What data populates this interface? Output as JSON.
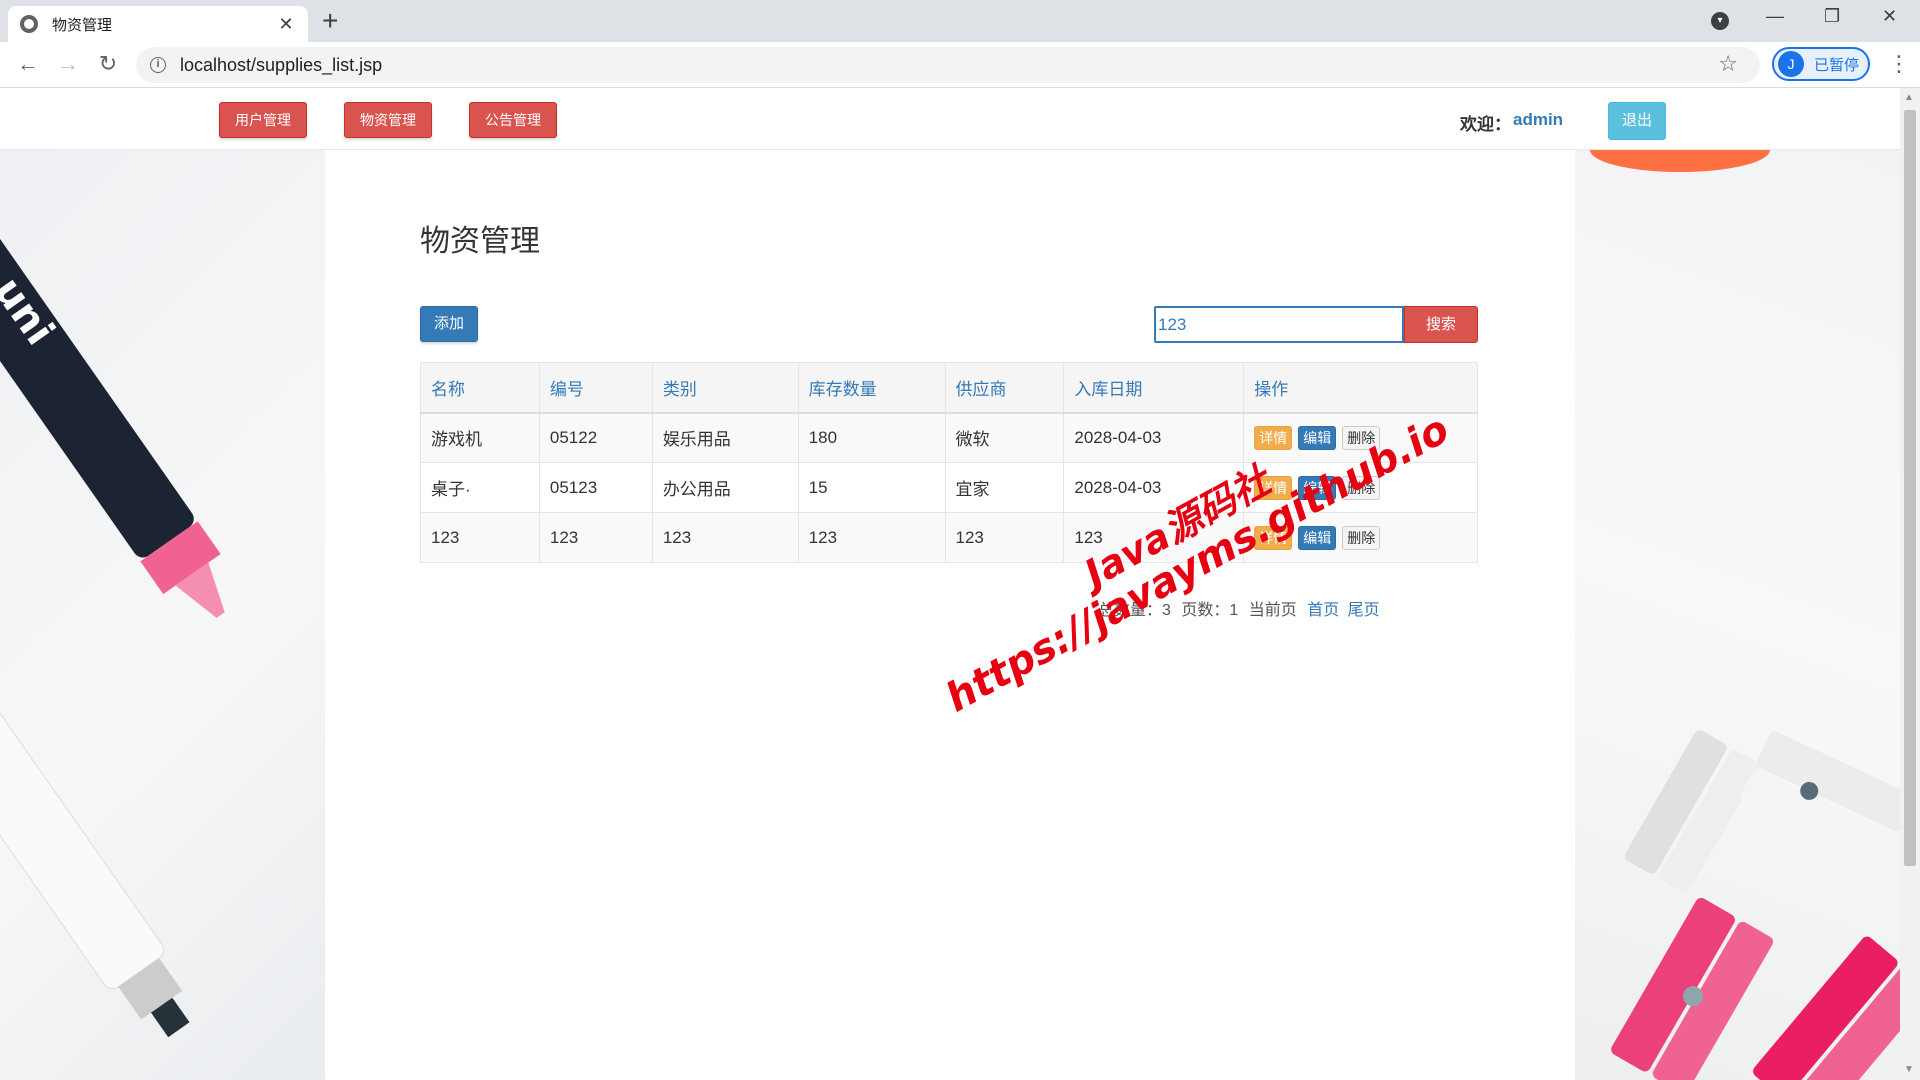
{
  "browser": {
    "tab_title": "物资管理",
    "tab_close": "✕",
    "new_tab": "+",
    "url": "localhost/supplies_list.jsp",
    "profile_initial": "J",
    "profile_status": "已暂停",
    "icons": [
      "back-icon",
      "forward-icon",
      "reload-icon",
      "info-icon",
      "star-icon",
      "menu-icon"
    ]
  },
  "navbar": {
    "buttons": [
      "用户管理",
      "物资管理",
      "公告管理"
    ],
    "welcome_label": "欢迎：",
    "username": "admin",
    "logout": "退出"
  },
  "page": {
    "title": "物资管理",
    "add_button": "添加",
    "search_value": "123",
    "search_button": "搜索"
  },
  "table": {
    "headers": [
      "名称",
      "编号",
      "类别",
      "库存数量",
      "供应商",
      "入库日期",
      "操作"
    ],
    "rows": [
      [
        "游戏机",
        "05122",
        "娱乐用品",
        "180",
        "微软",
        "2028-04-03"
      ],
      [
        "桌子·",
        "05123",
        "办公用品",
        "15",
        "宜家",
        "2028-04-03"
      ],
      [
        "123",
        "123",
        "123",
        "123",
        "123",
        "123"
      ]
    ],
    "actions": [
      "详情",
      "编辑",
      "删除"
    ]
  },
  "pager": {
    "total_label": "总数量：3",
    "pages_label": "页数：1",
    "current_label": "当前页",
    "first": "首页",
    "last": "尾页"
  },
  "watermark": {
    "line1": "Java源码社",
    "line2": "https://javayms.github.io"
  },
  "colors": {
    "danger": "#d9534f",
    "primary": "#337ab7",
    "info": "#5bc0de",
    "warning": "#f0ad4e",
    "watermark": "#e60012"
  }
}
